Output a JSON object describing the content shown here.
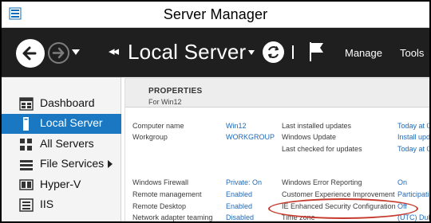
{
  "window": {
    "title": "Server Manager"
  },
  "toolbar": {
    "breadcrumb_separator": "◂◂",
    "page_title": "Local Server",
    "menu": {
      "manage": "Manage",
      "tools": "Tools"
    }
  },
  "sidebar": {
    "items": [
      {
        "label": "Dashboard",
        "icon": "dashboard-icon",
        "active": false
      },
      {
        "label": "Local Server",
        "icon": "local-server-icon",
        "active": true
      },
      {
        "label": "All Servers",
        "icon": "all-servers-icon",
        "active": false
      },
      {
        "label": "File Services",
        "icon": "file-services-icon",
        "active": false,
        "has_submenu": true
      },
      {
        "label": "Hyper-V",
        "icon": "hyper-v-icon",
        "active": false
      },
      {
        "label": "IIS",
        "icon": "iis-icon",
        "active": false
      }
    ]
  },
  "properties": {
    "title": "PROPERTIES",
    "subtitle": "For Win12",
    "left_column": [
      {
        "label": "Computer name",
        "value": "Win12"
      },
      {
        "label": "Workgroup",
        "value": "WORKGROUP"
      },
      {
        "label": "Windows Firewall",
        "value": "Private: On"
      },
      {
        "label": "Remote management",
        "value": "Enabled"
      },
      {
        "label": "Remote Desktop",
        "value": "Enabled"
      },
      {
        "label": "Network adapter teaming",
        "value": "Disabled"
      }
    ],
    "right_column": [
      {
        "label": "Last installed updates",
        "value": "Today at 0"
      },
      {
        "label": "Windows Update",
        "value": "Install upd"
      },
      {
        "label": "Last checked for updates",
        "value": "Today at 0"
      },
      {
        "label": "Windows Error Reporting",
        "value": "On"
      },
      {
        "label": "Customer Experience Improvement",
        "value": "Participati"
      },
      {
        "label": "IE Enhanced Security Configuration",
        "value": "Off"
      },
      {
        "label": "Time zone",
        "value": "(UTC) Dub"
      }
    ]
  },
  "colors": {
    "accent": "#1a78c2",
    "toolbar_bg": "#1f1f1f",
    "link": "#1f69b6",
    "highlight_ring": "#c63a2e"
  }
}
